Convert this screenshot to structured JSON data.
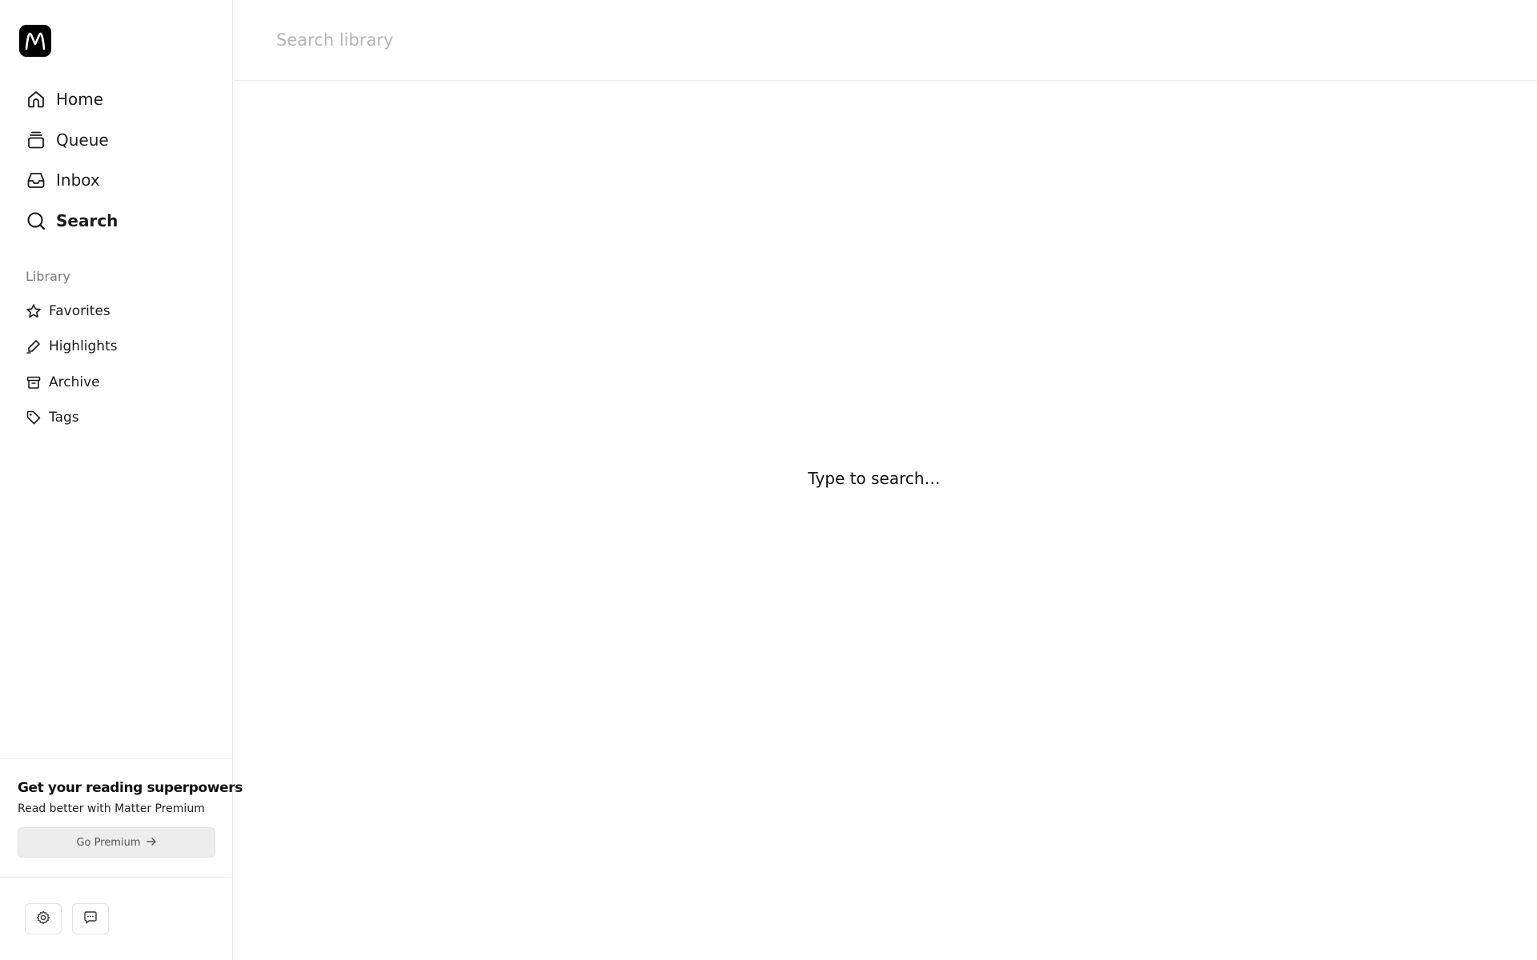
{
  "app": {
    "brand_color": "#000000"
  },
  "sidebar": {
    "logo_icon": "matter-logo-icon",
    "nav": [
      {
        "label": "Home",
        "icon": "home-icon",
        "active": false
      },
      {
        "label": "Queue",
        "icon": "queue-stack-icon",
        "active": false
      },
      {
        "label": "Inbox",
        "icon": "inbox-tray-icon",
        "active": false
      },
      {
        "label": "Search",
        "icon": "search-icon",
        "active": true
      }
    ],
    "library_title": "Library",
    "library": [
      {
        "label": "Favorites",
        "icon": "star-icon"
      },
      {
        "label": "Highlights",
        "icon": "highlighter-icon"
      },
      {
        "label": "Archive",
        "icon": "archive-box-icon"
      },
      {
        "label": "Tags",
        "icon": "tag-icon"
      }
    ],
    "promo": {
      "title": "Get your reading superpowers",
      "subtitle": "Read better with Matter Premium",
      "button_label": "Go Premium"
    },
    "footer": {
      "settings_icon": "gear-icon",
      "feedback_icon": "chat-bubble-icon"
    }
  },
  "main": {
    "search": {
      "placeholder": "Search library",
      "value": ""
    },
    "empty_hint": "Type to search…"
  }
}
